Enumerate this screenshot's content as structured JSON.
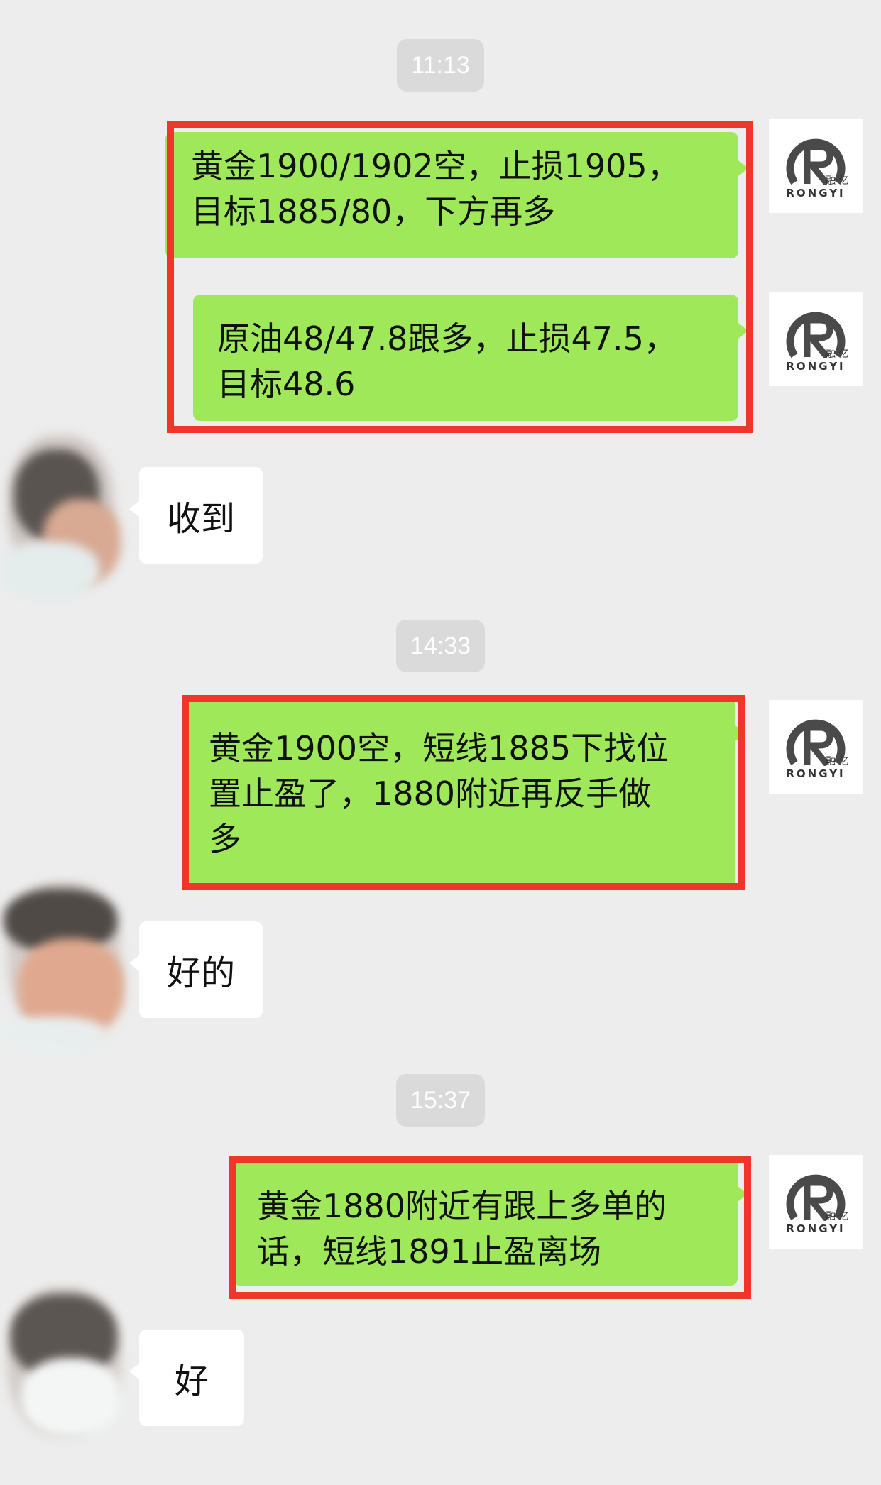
{
  "colors": {
    "background": "#ededed",
    "sent_bubble": "#9fe85a",
    "received_bubble": "#ffffff",
    "highlight_box": "#f0352b",
    "timestamp_pill": "#dadada"
  },
  "self_avatar": {
    "icon": "rongyi-logo-icon",
    "brand": "RONGYI",
    "cn": "融 亿"
  },
  "timestamps": [
    "11:13",
    "14:33",
    "15:37"
  ],
  "messages": [
    {
      "from": "me",
      "lines": [
        "黄金1900/1902空，止损1905，",
        "目标1885/80，下方再多"
      ]
    },
    {
      "from": "me",
      "lines": [
        "原油48/47.8跟多，止损47.5，",
        "目标48.6"
      ]
    },
    {
      "from": "other",
      "text": "收到"
    },
    {
      "from": "me",
      "lines": [
        "黄金1900空，短线1885下找位",
        "置止盈了，1880附近再反手做",
        "多"
      ]
    },
    {
      "from": "other",
      "text": "好的"
    },
    {
      "from": "me",
      "lines": [
        "黄金1880附近有跟上多单的",
        "话，短线1891止盈离场"
      ]
    },
    {
      "from": "other",
      "text": "好"
    }
  ]
}
